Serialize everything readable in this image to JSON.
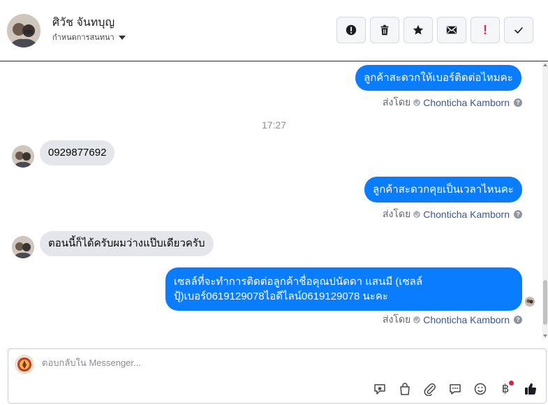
{
  "header": {
    "contact_name": "ศิวัช จันทบุญ",
    "assign_label": "กำหนดการสนทนา",
    "actions": [
      {
        "name": "report-spam-button",
        "icon": "alert-circle-icon"
      },
      {
        "name": "delete-button",
        "icon": "trash-icon"
      },
      {
        "name": "star-button",
        "icon": "star-icon"
      },
      {
        "name": "mark-unread-button",
        "icon": "envelope-icon"
      },
      {
        "name": "follow-up-button",
        "icon": "exclamation-icon"
      },
      {
        "name": "mark-done-button",
        "icon": "check-icon"
      }
    ]
  },
  "thread": {
    "messages": [
      {
        "direction": "out",
        "text": "ลูกค้าสะดวกให้เบอร์ติดต่อไหมคะ",
        "sent_by_label": "ส่งโดย",
        "author": "Chonticha Kamborn"
      },
      {
        "timestamp": "17:27"
      },
      {
        "direction": "in",
        "text": "0929877692"
      },
      {
        "direction": "out",
        "text": "ลูกค้าสะดวกคุยเป็นเวลาไหนคะ",
        "sent_by_label": "ส่งโดย",
        "author": "Chonticha Kamborn"
      },
      {
        "direction": "in",
        "text": "ตอนนี้ก็ได้ครับผมว่างแป๊บเดียวครับ"
      },
      {
        "direction": "out",
        "text": "เซลล์ที่จะทำการติดต่อลูกค้าชื่อคุณปนัดดา แสนมี (เซลล์ปุ้)เบอร์0619129078ไอดีไลน์0619129078 นะคะ",
        "sent_by_label": "ส่งโดย",
        "author": "Chonticha Kamborn"
      }
    ]
  },
  "composer": {
    "placeholder": "ตอบกลับใน Messenger...",
    "tools": [
      "saved-reply-icon",
      "shop-bag-icon",
      "attachment-icon",
      "chat-bubble-icon",
      "emoji-icon",
      "baht-payment-icon",
      "like-icon"
    ],
    "baht_symbol": "฿"
  },
  "colors": {
    "outgoing_bubble": "#0a7cff",
    "incoming_bubble": "#e4e6eb",
    "author_link": "#385898"
  }
}
